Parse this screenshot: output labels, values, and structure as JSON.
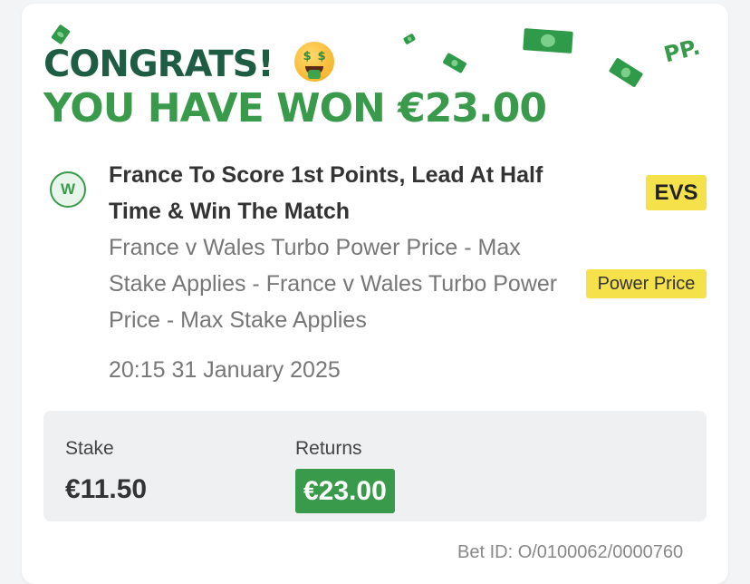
{
  "header": {
    "congrats": "CONGRATS!",
    "emoji": "money-mouth-face",
    "won_text": "YOU HAVE WON €23.00",
    "logo_text": "PP."
  },
  "bet": {
    "result_badge": "W",
    "title": "France To Score 1st Points, Lead At Half Time & Win The Match",
    "description": "France v Wales Turbo Power Price - Max Stake Applies - France v Wales Turbo Power Price - Max Stake Applies",
    "datetime": "20:15 31 January 2025",
    "odds": "EVS",
    "tag": "Power Price"
  },
  "summary": {
    "stake_label": "Stake",
    "stake_value": "€11.50",
    "returns_label": "Returns",
    "returns_value": "€23.00"
  },
  "footer": {
    "bet_id": "Bet ID: O/0100062/0000760"
  },
  "colors": {
    "dark_green": "#1f5c44",
    "brand_green": "#3a9a4c",
    "highlight_yellow": "#f5e24a",
    "summary_bg": "#eef0f2"
  }
}
